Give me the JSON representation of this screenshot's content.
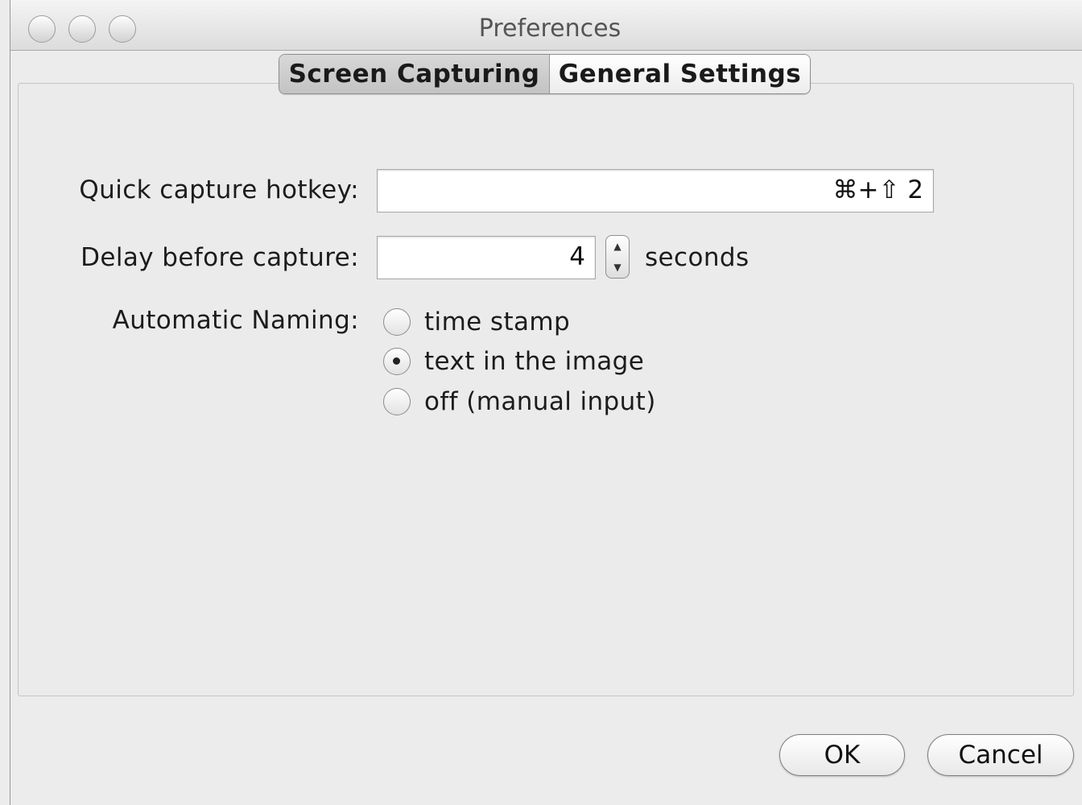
{
  "window": {
    "title": "Preferences"
  },
  "tabs": [
    {
      "label": "Screen Capturing",
      "active": true
    },
    {
      "label": "General Settings",
      "active": false
    }
  ],
  "form": {
    "hotkey_label": "Quick capture hotkey:",
    "hotkey_value": "⌘+⇧ 2",
    "delay_label": "Delay before capture:",
    "delay_value": "4",
    "delay_unit": "seconds",
    "naming_label": "Automatic Naming:",
    "naming_options": [
      {
        "label": "time stamp",
        "selected": false
      },
      {
        "label": "text in the image",
        "selected": true
      },
      {
        "label": "off (manual input)",
        "selected": false
      }
    ]
  },
  "buttons": {
    "ok": "OK",
    "cancel": "Cancel"
  },
  "icons": {
    "close": "close-icon",
    "minimize": "minimize-icon",
    "zoom": "zoom-icon",
    "stepper_up": "chevron-up-icon",
    "stepper_down": "chevron-down-icon"
  }
}
